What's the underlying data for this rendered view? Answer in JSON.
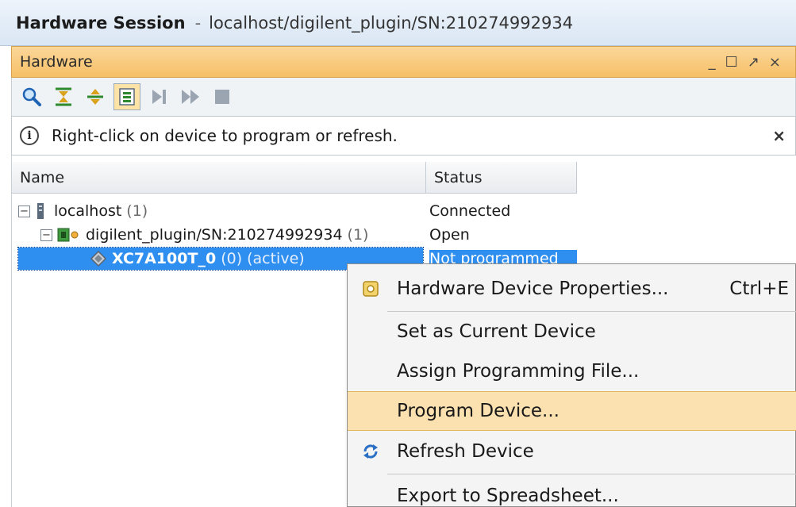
{
  "session": {
    "title": "Hardware Session",
    "separator": "-",
    "path": "localhost/digilent_plugin/SN:210274992934"
  },
  "panel": {
    "title": "Hardware",
    "window_buttons": [
      "_",
      "☐",
      "↗",
      "×"
    ]
  },
  "toolbar": {
    "buttons": [
      "search-icon",
      "collapse-all-icon",
      "expand-all-icon",
      "auto-connect-icon",
      "run-trigger-icon",
      "run-trigger-immediate-icon",
      "stop-trigger-icon"
    ]
  },
  "info": {
    "icon_text": "i",
    "message": "Right-click on device to program or refresh.",
    "close": "×"
  },
  "tree": {
    "columns": {
      "name": "Name",
      "status": "Status"
    },
    "rows": [
      {
        "expander": "−",
        "label": "localhost",
        "count": "(1)",
        "status": "Connected"
      },
      {
        "expander": "−",
        "label": "digilent_plugin/SN:210274992934",
        "count": "(1)",
        "status": "Open"
      },
      {
        "label": "XC7A100T_0",
        "count": "(0)",
        "extra": "(active)",
        "status": "Not programmed"
      }
    ]
  },
  "context_menu": {
    "items": [
      {
        "label": "Hardware Device Properties...",
        "shortcut": "Ctrl+E",
        "icon": "properties-icon"
      },
      {
        "label": "Set as Current Device"
      },
      {
        "label": "Assign Programming File..."
      },
      {
        "label": "Program Device..."
      },
      {
        "label": "Refresh Device",
        "icon": "refresh-icon"
      },
      {
        "label": "Export to Spreadsheet..."
      }
    ]
  },
  "colors": {
    "panel_header": "#f6bf66",
    "selection": "#2f8ff0",
    "menu_hover": "#fbe1b0"
  }
}
